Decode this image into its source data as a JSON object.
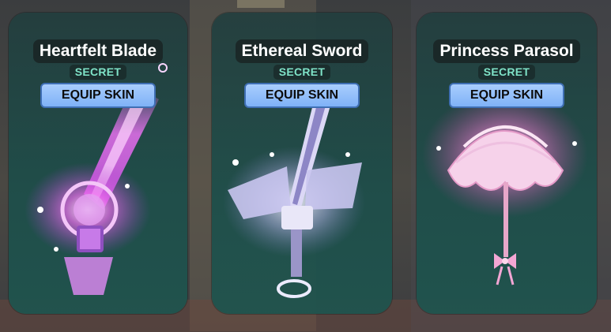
{
  "cards": [
    {
      "name": "Heartfelt Blade",
      "rarity": "SECRET",
      "button_label": "EQUIP SKIN",
      "item_icon": "heartfelt-blade-icon",
      "accent": "#e06cf0"
    },
    {
      "name": "Ethereal Sword",
      "rarity": "SECRET",
      "button_label": "EQUIP SKIN",
      "item_icon": "ethereal-sword-icon",
      "accent": "#d9d6f5"
    },
    {
      "name": "Princess Parasol",
      "rarity": "SECRET",
      "button_label": "EQUIP SKIN",
      "item_icon": "princess-parasol-icon",
      "accent": "#f4a6d8"
    }
  ],
  "colors": {
    "rarity_text": "#7fe3c8",
    "button_fill": "#8dbcf9",
    "button_border": "#3f6fb4",
    "card_fill": "#1f4e4a"
  }
}
